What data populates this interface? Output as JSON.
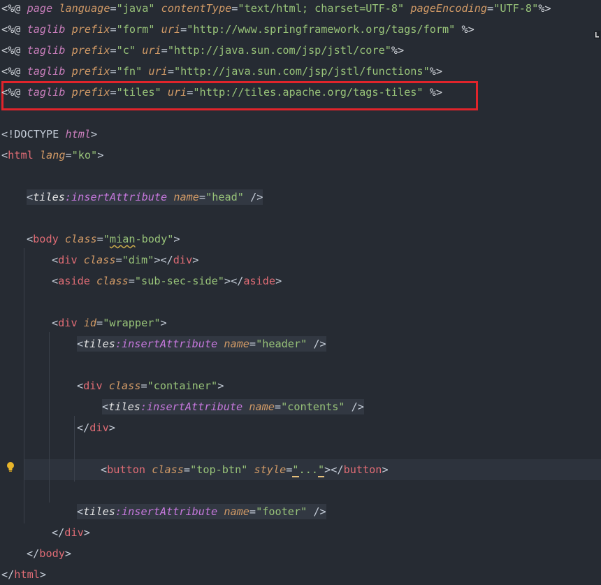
{
  "editor": {
    "lines": [
      {
        "segments": [
          [
            "<%@ ",
            "dir"
          ],
          [
            "page",
            "kw"
          ],
          [
            " ",
            "p"
          ],
          [
            "language",
            "attr"
          ],
          [
            "=",
            "p"
          ],
          [
            "\"java\"",
            "str"
          ],
          [
            " ",
            "p"
          ],
          [
            "contentType",
            "attr"
          ],
          [
            "=",
            "p"
          ],
          [
            "\"text/html; charset=UTF-8\"",
            "str"
          ],
          [
            " ",
            "p"
          ],
          [
            "pageEncoding",
            "attr"
          ],
          [
            "=",
            "p"
          ],
          [
            "\"UTF-8\"",
            "str"
          ],
          [
            "%>",
            "dir"
          ]
        ]
      },
      {
        "segments": [
          [
            "<%@ ",
            "dir"
          ],
          [
            "taglib",
            "kw"
          ],
          [
            " ",
            "p"
          ],
          [
            "prefix",
            "attr"
          ],
          [
            "=",
            "p"
          ],
          [
            "\"form\"",
            "str"
          ],
          [
            " ",
            "p"
          ],
          [
            "uri",
            "attr"
          ],
          [
            "=",
            "p"
          ],
          [
            "\"http://www.springframework.org/tags/form\"",
            "str"
          ],
          [
            " %>",
            "dir"
          ]
        ]
      },
      {
        "segments": [
          [
            "<%@ ",
            "dir"
          ],
          [
            "taglib",
            "kw"
          ],
          [
            " ",
            "p"
          ],
          [
            "prefix",
            "attr"
          ],
          [
            "=",
            "p"
          ],
          [
            "\"c\"",
            "str"
          ],
          [
            " ",
            "p"
          ],
          [
            "uri",
            "attr"
          ],
          [
            "=",
            "p"
          ],
          [
            "\"http://java.sun.com/jsp/jstl/core\"",
            "str"
          ],
          [
            "%>",
            "dir"
          ]
        ]
      },
      {
        "segments": [
          [
            "<%@ ",
            "dir"
          ],
          [
            "taglib",
            "kw"
          ],
          [
            " ",
            "p"
          ],
          [
            "prefix",
            "attr"
          ],
          [
            "=",
            "p"
          ],
          [
            "\"fn\"",
            "str"
          ],
          [
            " ",
            "p"
          ],
          [
            "uri",
            "attr"
          ],
          [
            "=",
            "p"
          ],
          [
            "\"http://java.sun.com/jsp/jstl/functions\"",
            "str"
          ],
          [
            "%>",
            "dir"
          ]
        ]
      },
      {
        "segments": [
          [
            "<%@ ",
            "dir"
          ],
          [
            "taglib",
            "kw"
          ],
          [
            " ",
            "p"
          ],
          [
            "prefix",
            "attr"
          ],
          [
            "=",
            "p"
          ],
          [
            "\"tiles\"",
            "str"
          ],
          [
            " ",
            "p"
          ],
          [
            "uri",
            "attr"
          ],
          [
            "=",
            "p"
          ],
          [
            "\"http://tiles.apache.org/tags-tiles\"",
            "str"
          ],
          [
            " %>",
            "dir"
          ]
        ]
      },
      {
        "segments": []
      },
      {
        "segments": [
          [
            "<!DOCTYPE ",
            "doctype"
          ],
          [
            "html",
            "kw"
          ],
          [
            ">",
            "doctype"
          ]
        ]
      },
      {
        "segments": [
          [
            "<",
            "p"
          ],
          [
            "html",
            "tag"
          ],
          [
            " ",
            "p"
          ],
          [
            "lang",
            "attr"
          ],
          [
            "=",
            "p"
          ],
          [
            "\"ko\"",
            "str"
          ],
          [
            ">",
            "p"
          ]
        ]
      },
      {
        "segments": []
      },
      {
        "indent": 1,
        "hl": true,
        "segments": [
          [
            "<",
            "p"
          ],
          [
            "tiles",
            "ns"
          ],
          [
            ":insertAttribute",
            "nsname"
          ],
          [
            " ",
            "p"
          ],
          [
            "name",
            "attr"
          ],
          [
            "=",
            "p"
          ],
          [
            "\"head\"",
            "str"
          ],
          [
            " />",
            "p"
          ]
        ]
      },
      {
        "segments": []
      },
      {
        "indent": 1,
        "segments": [
          [
            "<",
            "p"
          ],
          [
            "body",
            "tag"
          ],
          [
            " ",
            "p"
          ],
          [
            "class",
            "attr"
          ],
          [
            "=",
            "p"
          ],
          [
            "\"",
            "str"
          ],
          [
            "mian",
            "sq"
          ],
          [
            "-body\"",
            "str"
          ],
          [
            ">",
            "p"
          ]
        ]
      },
      {
        "indent": 2,
        "segments": [
          [
            "<",
            "p"
          ],
          [
            "div",
            "tag"
          ],
          [
            " ",
            "p"
          ],
          [
            "class",
            "attr"
          ],
          [
            "=",
            "p"
          ],
          [
            "\"dim\"",
            "str"
          ],
          [
            "></",
            "p"
          ],
          [
            "div",
            "tag"
          ],
          [
            ">",
            "p"
          ]
        ]
      },
      {
        "indent": 2,
        "segments": [
          [
            "<",
            "p"
          ],
          [
            "aside",
            "tag"
          ],
          [
            " ",
            "p"
          ],
          [
            "class",
            "attr"
          ],
          [
            "=",
            "p"
          ],
          [
            "\"sub-sec-side\"",
            "str"
          ],
          [
            "></",
            "p"
          ],
          [
            "aside",
            "tag"
          ],
          [
            ">",
            "p"
          ]
        ]
      },
      {
        "segments": []
      },
      {
        "indent": 2,
        "segments": [
          [
            "<",
            "p"
          ],
          [
            "div",
            "tag"
          ],
          [
            " ",
            "p"
          ],
          [
            "id",
            "attr"
          ],
          [
            "=",
            "p"
          ],
          [
            "\"wrapper\"",
            "str"
          ],
          [
            ">",
            "p"
          ]
        ]
      },
      {
        "indent": 3,
        "hl": true,
        "segments": [
          [
            "<",
            "p"
          ],
          [
            "tiles",
            "ns"
          ],
          [
            ":insertAttribute",
            "nsname"
          ],
          [
            " ",
            "p"
          ],
          [
            "name",
            "attr"
          ],
          [
            "=",
            "p"
          ],
          [
            "\"header\"",
            "str"
          ],
          [
            " />",
            "p"
          ]
        ]
      },
      {
        "segments": []
      },
      {
        "indent": 3,
        "segments": [
          [
            "<",
            "p"
          ],
          [
            "div",
            "tag"
          ],
          [
            " ",
            "p"
          ],
          [
            "class",
            "attr"
          ],
          [
            "=",
            "p"
          ],
          [
            "\"container\"",
            "str"
          ],
          [
            ">",
            "p"
          ]
        ]
      },
      {
        "indent": 4,
        "hl": true,
        "segments": [
          [
            "<",
            "p"
          ],
          [
            "tiles",
            "ns"
          ],
          [
            ":insertAttribute",
            "nsname"
          ],
          [
            " ",
            "p"
          ],
          [
            "name",
            "attr"
          ],
          [
            "=",
            "p"
          ],
          [
            "\"contents\"",
            "str"
          ],
          [
            " />",
            "p"
          ]
        ]
      },
      {
        "indent": 3,
        "segments": [
          [
            "</",
            "p"
          ],
          [
            "div",
            "tag"
          ],
          [
            ">",
            "p"
          ]
        ]
      },
      {
        "segments": []
      },
      {
        "indent": 3,
        "current": true,
        "segments": [
          [
            "<",
            "p"
          ],
          [
            "button",
            "tag"
          ],
          [
            " ",
            "p"
          ],
          [
            "class",
            "attr"
          ],
          [
            "=",
            "p"
          ],
          [
            "\"top-btn\"",
            "str"
          ],
          [
            " ",
            "p"
          ],
          [
            "style",
            "attr"
          ],
          [
            "=",
            "p"
          ],
          [
            "\"",
            "bm"
          ],
          [
            "...",
            "str"
          ],
          [
            "\"",
            "bm"
          ],
          [
            "></",
            "p"
          ],
          [
            "button",
            "tag"
          ],
          [
            ">",
            "p"
          ]
        ]
      },
      {
        "segments": []
      },
      {
        "indent": 3,
        "hl": true,
        "segments": [
          [
            "<",
            "p"
          ],
          [
            "tiles",
            "ns"
          ],
          [
            ":insertAttribute",
            "nsname"
          ],
          [
            " ",
            "p"
          ],
          [
            "name",
            "attr"
          ],
          [
            "=",
            "p"
          ],
          [
            "\"footer\"",
            "str"
          ],
          [
            " />",
            "p"
          ]
        ]
      },
      {
        "indent": 2,
        "segments": [
          [
            "</",
            "p"
          ],
          [
            "div",
            "tag"
          ],
          [
            ">",
            "p"
          ]
        ]
      },
      {
        "indent": 1,
        "segments": [
          [
            "</",
            "p"
          ],
          [
            "body",
            "tag"
          ],
          [
            ">",
            "p"
          ]
        ]
      },
      {
        "segments": [
          [
            "</",
            "p"
          ],
          [
            "html",
            "tag"
          ],
          [
            ">",
            "p"
          ]
        ]
      }
    ]
  },
  "colors": {
    "background": "#262b33",
    "highlight_box": "#e0242b",
    "string": "#98c379",
    "tag": "#e06c75",
    "attribute": "#d19a66",
    "keyword": "#c77dba"
  },
  "icons": {
    "gutter": "lightbulb-icon",
    "scrollbar": "inspection-status-icon"
  }
}
